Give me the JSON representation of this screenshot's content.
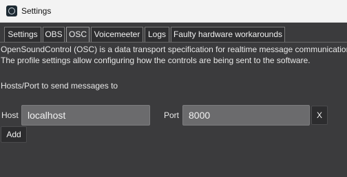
{
  "window": {
    "title": "Settings",
    "icon": "app-icon"
  },
  "tabs": [
    {
      "label": "Settings",
      "active": false
    },
    {
      "label": "OBS",
      "active": false
    },
    {
      "label": "OSC",
      "active": true
    },
    {
      "label": "Voicemeeter",
      "active": false
    },
    {
      "label": "Logs",
      "active": false
    },
    {
      "label": "Faulty hardware workarounds",
      "active": false
    }
  ],
  "osc": {
    "description_line1": "OpenSoundControl (OSC) is a data transport specification for realtime message communication",
    "description_line2": "The profile settings allow configuring how the controls are being sent to the software.",
    "hosts_heading": "Hosts/Port to send messages to",
    "host_label": "Host",
    "host_value": "localhost",
    "port_label": "Port",
    "port_value": "8000",
    "remove_label": "X",
    "add_label": "Add"
  },
  "colors": {
    "background": "#3b3b3d",
    "field": "#6b6b6d",
    "titlebar": "#f3f3f3"
  }
}
